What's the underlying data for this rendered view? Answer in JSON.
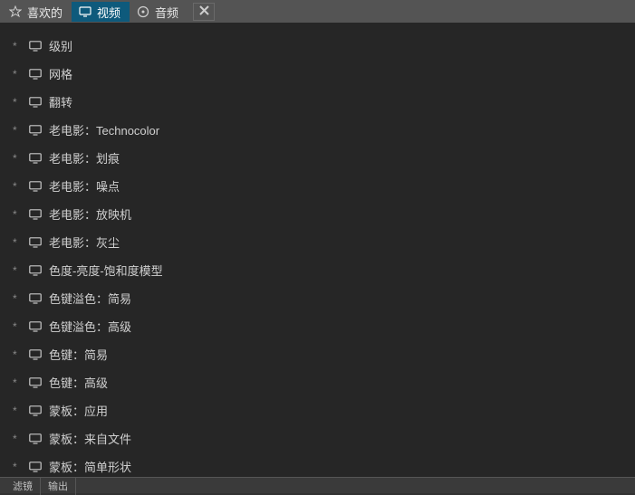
{
  "tabs": [
    {
      "label": "喜欢的",
      "icon": "star",
      "active": false
    },
    {
      "label": "视频",
      "icon": "monitor",
      "active": true
    },
    {
      "label": "音频",
      "icon": "disc",
      "active": false
    }
  ],
  "items": [
    {
      "label": "级别"
    },
    {
      "label": "网格"
    },
    {
      "label": "翻转"
    },
    {
      "label": "老电影：Technocolor"
    },
    {
      "label": "老电影：划痕"
    },
    {
      "label": "老电影：噪点"
    },
    {
      "label": "老电影：放映机"
    },
    {
      "label": "老电影：灰尘"
    },
    {
      "label": "色度-亮度-饱和度模型"
    },
    {
      "label": "色键溢色：简易"
    },
    {
      "label": "色键溢色：高级"
    },
    {
      "label": "色键：简易"
    },
    {
      "label": "色键：高级"
    },
    {
      "label": "蒙板：应用"
    },
    {
      "label": "蒙板：来自文件"
    },
    {
      "label": "蒙板：简单形状"
    }
  ],
  "bottom": {
    "tab1": "滤镜",
    "tab2": "输出"
  }
}
